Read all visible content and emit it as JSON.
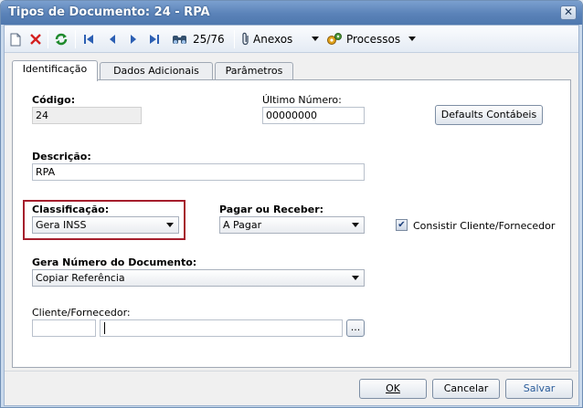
{
  "window": {
    "title": "Tipos de Documento: 24 - RPA",
    "close_glyph": "✕"
  },
  "toolbar": {
    "record_position": "25/76",
    "anexos_label": "Anexos",
    "processos_label": "Processos"
  },
  "tabs": [
    {
      "label": "Identificação"
    },
    {
      "label": "Dados Adicionais"
    },
    {
      "label": "Parâmetros"
    }
  ],
  "form": {
    "codigo_label": "Código:",
    "codigo_value": "24",
    "ultimo_numero_label": "Último Número:",
    "ultimo_numero_value": "00000000",
    "defaults_button": "Defaults Contábeis",
    "descricao_label": "Descrição:",
    "descricao_value": "RPA",
    "classificacao_label": "Classificação:",
    "classificacao_value": "Gera INSS",
    "pagar_receber_label": "Pagar ou Receber:",
    "pagar_receber_value": "A Pagar",
    "consistir_label": "Consistir Cliente/Fornecedor",
    "consistir_checked": true,
    "gera_numero_label": "Gera Número do Documento:",
    "gera_numero_value": "Copiar Referência",
    "cliente_label": "Cliente/Fornecedor:",
    "cliente_code": "",
    "cliente_name": "",
    "browse_label": "..."
  },
  "footer": {
    "ok_label": "OK",
    "cancel_label": "Cancelar",
    "save_label": "Salvar"
  },
  "colors": {
    "title_bar": "#5a82b8",
    "highlight": "#a51e2c",
    "refresh": "#1f8a2d",
    "delete": "#d42020",
    "nav": "#2c5fb3"
  }
}
